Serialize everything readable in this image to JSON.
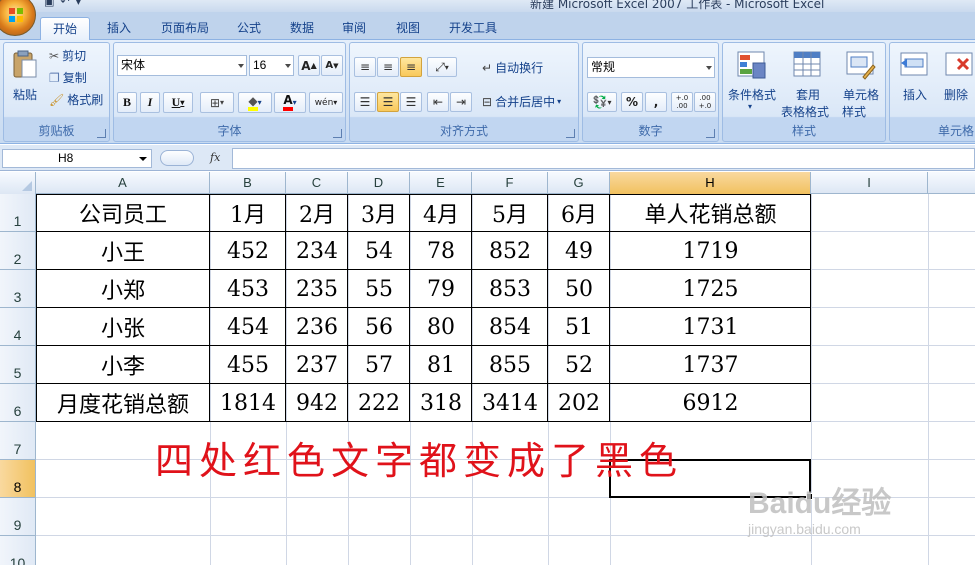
{
  "window": {
    "title": "新建 Microsoft Excel 2007 工作表 - Microsoft Excel"
  },
  "tabs": [
    "开始",
    "插入",
    "页面布局",
    "公式",
    "数据",
    "审阅",
    "视图",
    "开发工具"
  ],
  "active_tab": "开始",
  "ribbon": {
    "clipboard": {
      "label": "剪贴板",
      "paste": "粘贴",
      "cut": "剪切",
      "copy": "复制",
      "format_painter": "格式刷"
    },
    "font": {
      "label": "字体",
      "name": "宋体",
      "size": "16",
      "bold": "B",
      "italic": "I",
      "underline": "U",
      "grow": "A",
      "shrink": "A",
      "font_color_letter": "A",
      "phonetic": "wén"
    },
    "alignment": {
      "label": "对齐方式",
      "wrap": "自动换行",
      "merge": "合并后居中"
    },
    "number": {
      "label": "数字",
      "format": "常规",
      "percent": "%",
      "comma": ",",
      "inc_decimal": "+.0 .00",
      "dec_decimal": ".00 +.0"
    },
    "styles": {
      "label": "样式",
      "conditional": "条件格式",
      "table_line1": "套用",
      "table_line2": "表格格式",
      "cell_line1": "单元格",
      "cell_line2": "样式"
    },
    "cells": {
      "label": "单元格",
      "insert": "插入",
      "delete": "删除"
    }
  },
  "formula_bar": {
    "name_box": "H8",
    "fx": "fx",
    "formula": ""
  },
  "columns": [
    "A",
    "B",
    "C",
    "D",
    "E",
    "F",
    "G",
    "H",
    "I"
  ],
  "rows": [
    "1",
    "2",
    "3",
    "4",
    "5",
    "6",
    "7",
    "8",
    "9",
    "10"
  ],
  "selected_cell": "H8",
  "table": {
    "header": [
      "公司员工",
      "1月",
      "2月",
      "3月",
      "4月",
      "5月",
      "6月",
      "单人花销总额"
    ],
    "rows": [
      [
        "小王",
        "452",
        "234",
        "54",
        "78",
        "852",
        "49",
        "1719"
      ],
      [
        "小郑",
        "453",
        "235",
        "55",
        "79",
        "853",
        "50",
        "1725"
      ],
      [
        "小张",
        "454",
        "236",
        "56",
        "80",
        "854",
        "51",
        "1731"
      ],
      [
        "小李",
        "455",
        "237",
        "57",
        "81",
        "855",
        "52",
        "1737"
      ],
      [
        "月度花销总额",
        "1814",
        "942",
        "222",
        "318",
        "3414",
        "202",
        "6912"
      ]
    ]
  },
  "annotation": {
    "text": "四处红色文字都变成了黑色",
    "color": "#e0121a"
  },
  "watermark": {
    "brand": "Baidu经验",
    "url": "jingyan.baidu.com"
  },
  "colors": {
    "accent": "#15428b",
    "selected_header": "#f1c15f",
    "ribbon_bg": "#d3e2f4"
  }
}
